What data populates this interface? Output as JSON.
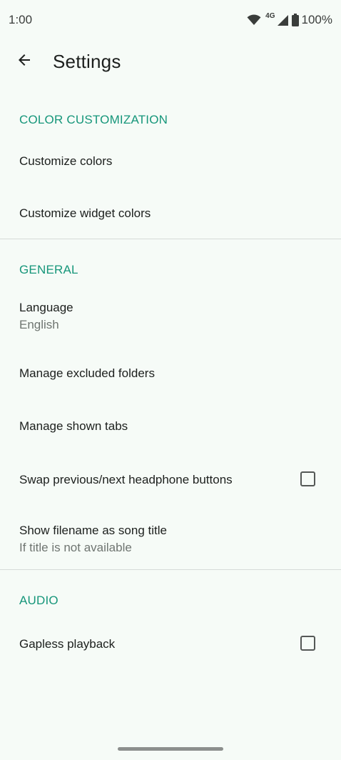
{
  "status_bar": {
    "time": "1:00",
    "network": "4G",
    "battery": "100%",
    "icons": [
      "wifi-icon",
      "cell-signal-icon",
      "battery-icon"
    ]
  },
  "app_bar": {
    "back_icon": "arrow-back-icon",
    "title": "Settings"
  },
  "sections": {
    "color": {
      "header": "COLOR CUSTOMIZATION",
      "customize_colors": "Customize colors",
      "customize_widget_colors": "Customize widget colors"
    },
    "general": {
      "header": "GENERAL",
      "language_title": "Language",
      "language_value": "English",
      "excluded_folders": "Manage excluded folders",
      "shown_tabs": "Manage shown tabs",
      "swap_buttons": "Swap previous/next headphone buttons",
      "swap_buttons_checked": false,
      "filename_title": "Show filename as song title",
      "filename_summary": "If title is not available"
    },
    "audio": {
      "header": "AUDIO",
      "gapless": "Gapless playback",
      "gapless_checked": false
    }
  },
  "colors": {
    "accent": "#16967a",
    "background": "#f6fbf7",
    "text_primary": "#1c1f1d",
    "text_secondary": "#6f7571"
  }
}
